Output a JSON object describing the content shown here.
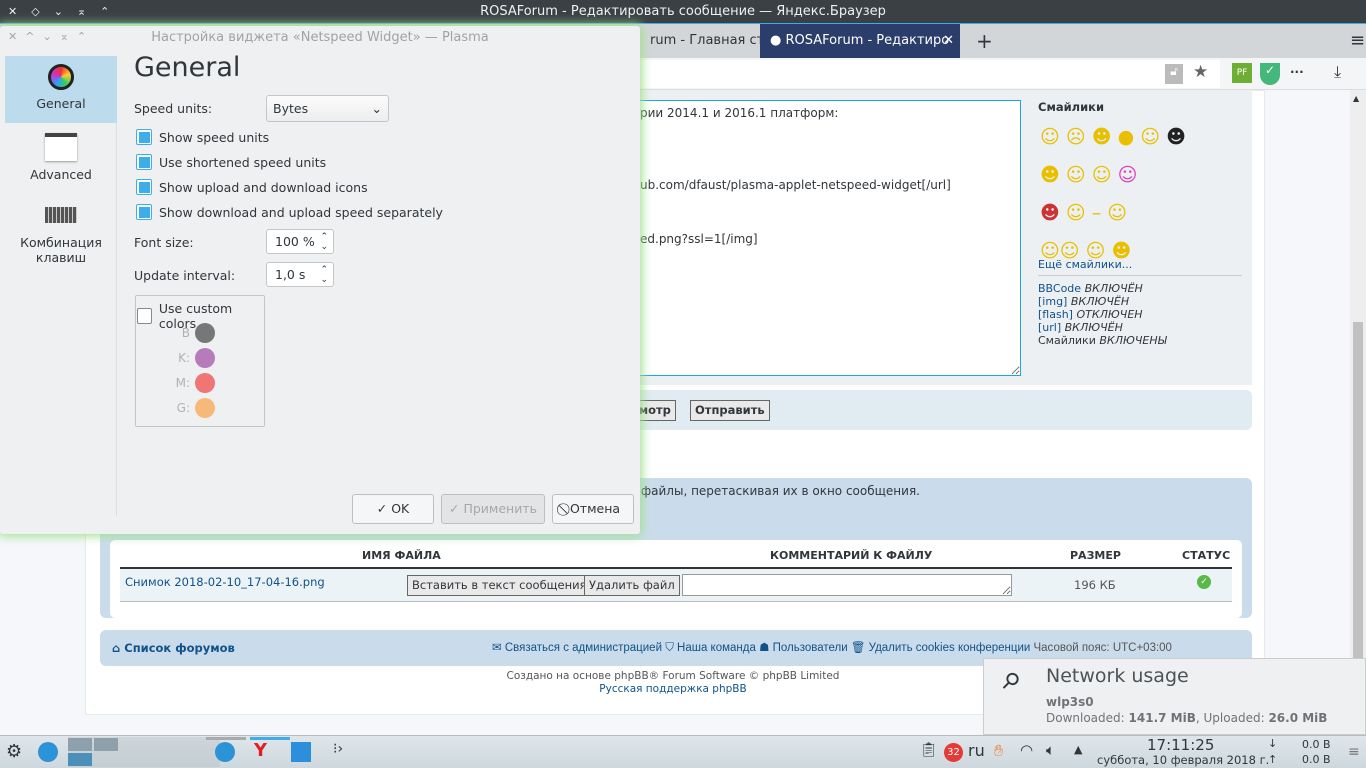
{
  "window": {
    "title": "ROSAForum - Редактировать сообщение — Яндекс.Браузер"
  },
  "browser": {
    "tabs": [
      {
        "label": "rum - Главная стра"
      },
      {
        "label": "ROSAForum - Редактиро",
        "active": true
      }
    ],
    "new_tab": "+",
    "menu": "≡",
    "ext_pf": "PF",
    "more": "..."
  },
  "forum": {
    "text_lines": [
      "рии 2014.1 и 2016.1 платформ:",
      "ub.com/dfaust/plasma-applet-netspeed-widget[/url]",
      "ed.png?ssl=1[/img]"
    ],
    "smilies_title": "Смайлики",
    "more_smilies": "Ещё смайлики...",
    "status": [
      {
        "k": "BBCode",
        "v": "ВКЛЮЧЁН"
      },
      {
        "k": "[img]",
        "v": "ВКЛЮЧЁН"
      },
      {
        "k": "[flash]",
        "v": "ОТКЛЮЧЕН"
      },
      {
        "k": "[url]",
        "v": "ВКЛЮЧЁН"
      },
      {
        "k": "Смайлики",
        "v": "ВКЛЮЧЕНЫ"
      }
    ],
    "preview_btn": "осмотр",
    "submit_btn": "Отправить",
    "drag_hint": "ь файлы, перетаскивая их в окно сообщения.",
    "attach": {
      "headers": [
        "ИМЯ ФАЙЛА",
        "КОММЕНТАРИЙ К ФАЙЛУ",
        "РАЗМЕР",
        "СТАТУС"
      ],
      "file": "Снимок 2018-02-10_17-04-16.png",
      "insert": "Вставить в текст сообщения",
      "delete": "Удалить файл",
      "comment": "",
      "size": "196 КБ"
    },
    "footer": {
      "forums": "Список форумов",
      "contact": "Связаться с администрацией",
      "team": "Наша команда",
      "users": "Пользователи",
      "cookies": "Удалить cookies конференции",
      "tz": "Часовой пояс: UTC+03:00"
    },
    "credits": [
      "Создано на основе phpBB® Forum Software © phpBB Limited",
      "Русская поддержка phpBB"
    ]
  },
  "dialog": {
    "title": "Настройка виджета «Netspeed Widget» — Plasma",
    "sidebar": [
      {
        "label": "General",
        "active": true
      },
      {
        "label": "Advanced"
      },
      {
        "label": "Комбинация клавиш"
      }
    ],
    "heading": "General",
    "speed_units_label": "Speed units:",
    "speed_units": "Bytes",
    "checks": [
      {
        "label": "Show speed units",
        "checked": true
      },
      {
        "label": "Use shortened speed units",
        "checked": true
      },
      {
        "label": "Show upload and download icons",
        "checked": true
      },
      {
        "label": "Show download and upload speed separately",
        "checked": true
      }
    ],
    "font_size_label": "Font size:",
    "font_size": "100 %",
    "interval_label": "Update interval:",
    "interval": "1,0 s",
    "custom_colors": {
      "label": "Use custom colors",
      "checked": false,
      "colors": [
        {
          "k": "B",
          "c": "#777777"
        },
        {
          "k": "K:",
          "c": "#b77bbb"
        },
        {
          "k": "M:",
          "c": "#f07575"
        },
        {
          "k": "G:",
          "c": "#f7b97a"
        }
      ]
    },
    "ok": "OK",
    "apply": "Применить",
    "cancel": "Отмена"
  },
  "network": {
    "title": "Network usage",
    "iface": "wlp3s0",
    "dl_label": "Downloaded:",
    "dl": "141.7 MiB",
    "ul_label": "Uploaded:",
    "ul": "26.0 MiB"
  },
  "taskbar": {
    "notif_count": "32",
    "lang": "ru",
    "time": "17:11:25",
    "date": "суббота, 10 февраля 2018 г.",
    "down": "0.0 B",
    "up": "0.0 B"
  }
}
